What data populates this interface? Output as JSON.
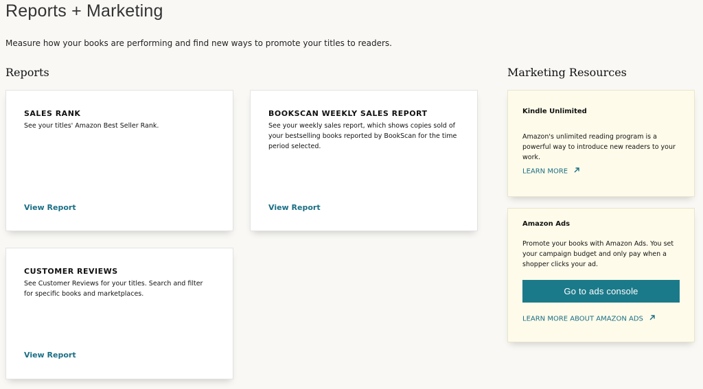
{
  "page": {
    "title": "Reports + Marketing",
    "subtitle": "Measure how your books are performing and find new ways to promote your titles to readers."
  },
  "reports": {
    "heading": "Reports",
    "cards": [
      {
        "title": "SALES RANK",
        "description": "See your titles' Amazon Best Seller Rank.",
        "link_label": "View Report"
      },
      {
        "title": "BOOKSCAN WEEKLY SALES REPORT",
        "description": "See your weekly sales report, which shows copies sold of your bestselling books reported by BookScan for the time period selected.",
        "link_label": "View Report"
      },
      {
        "title": "CUSTOMER REVIEWS",
        "description": "See Customer Reviews for your titles. Search and filter for specific books and marketplaces.",
        "link_label": "View Report"
      }
    ]
  },
  "marketing": {
    "heading": "Marketing Resources",
    "kindle_unlimited": {
      "title": "Kindle Unlimited",
      "description": "Amazon's unlimited reading program is a powerful way to introduce new readers to your work.",
      "link_label": "LEARN MORE"
    },
    "amazon_ads": {
      "title": "Amazon Ads",
      "description": "Promote your books with Amazon Ads. You set your campaign budget and only pay when a shopper clicks your ad.",
      "button_label": "Go to ads console",
      "link_label": "LEARN MORE ABOUT AMAZON ADS"
    }
  },
  "icons": {
    "external_link": "arrow-up-right-icon"
  },
  "colors": {
    "link": "#1a6e84",
    "button_bg": "#1b7a8a",
    "resource_card_bg": "#fefbea",
    "page_bg": "#f9f8f5"
  }
}
